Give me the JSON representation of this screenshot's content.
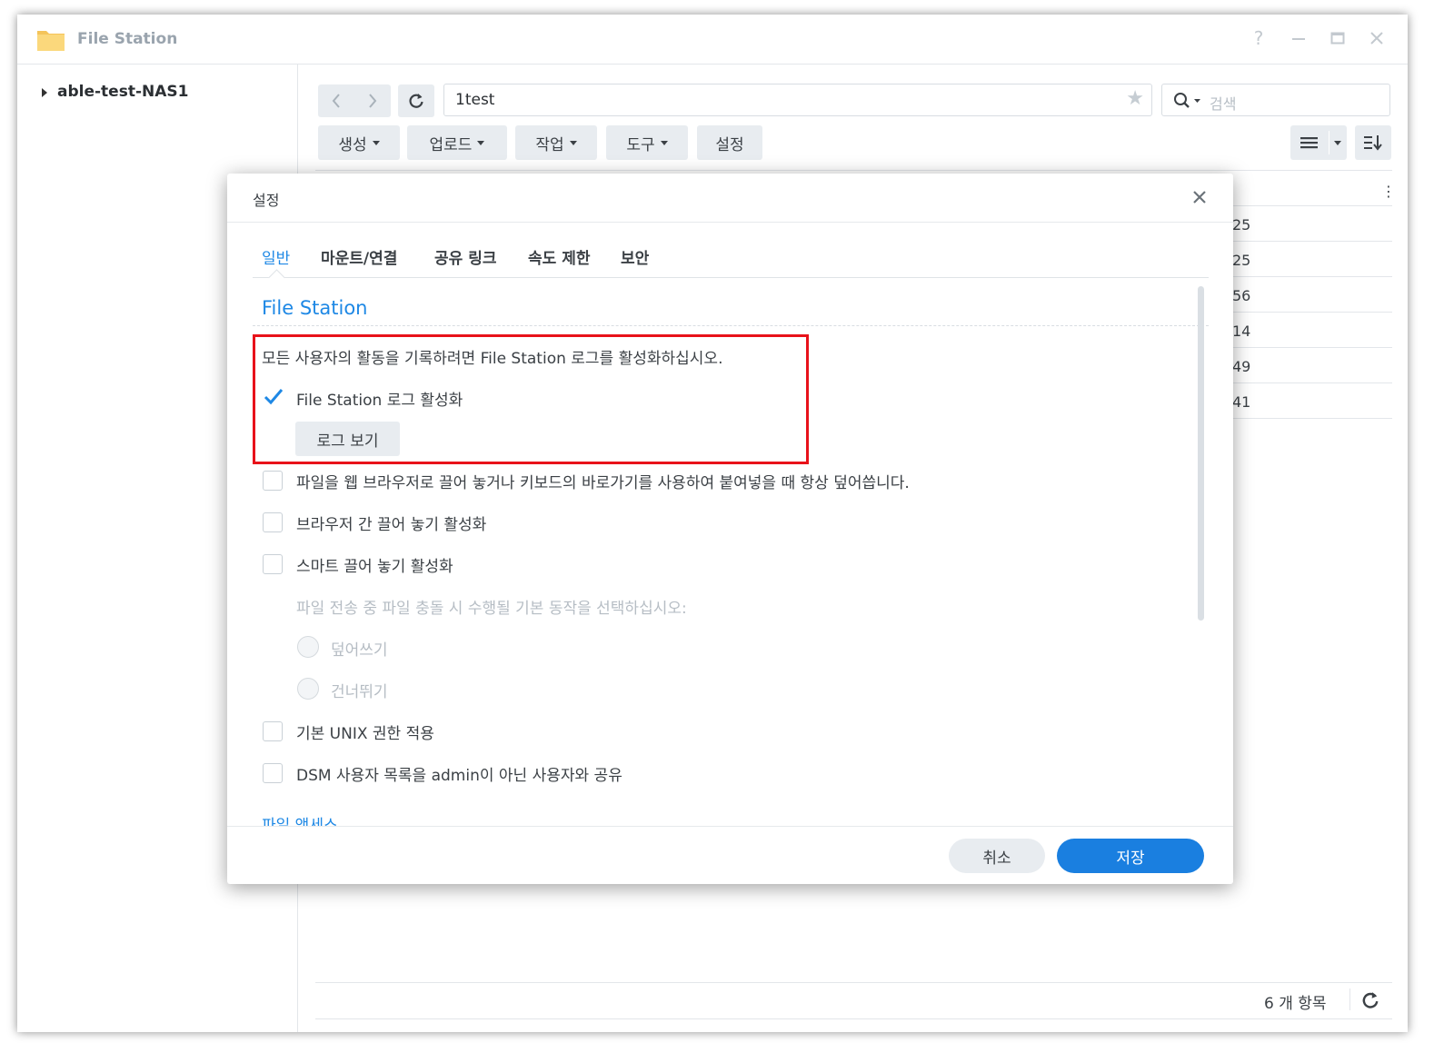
{
  "window": {
    "title": "File Station",
    "controls": [
      "help-icon",
      "minimize-icon",
      "maximize-icon",
      "close-icon"
    ]
  },
  "sidebar": {
    "tree_root": "able-test-NAS1"
  },
  "toolbar": {
    "path": "1test",
    "search_placeholder": "검색",
    "buttons": {
      "create": "생성",
      "upload": "업로드",
      "action": "작업",
      "tools": "도구",
      "settings": "설정"
    }
  },
  "file_list": {
    "partial_values": [
      "25",
      "25",
      "56",
      "14",
      "49",
      "41"
    ]
  },
  "status": {
    "item_count": "6 개 항목"
  },
  "dialog": {
    "title": "설정",
    "tabs": [
      "일반",
      "마운트/연결",
      "공유 링크",
      "속도 제한",
      "보안"
    ],
    "active_tab": "일반",
    "section_title": "File Station",
    "log_description": "모든 사용자의 활동을 기록하려면 File Station 로그를 활성화하십시오.",
    "enable_log_label": "File Station 로그 활성화",
    "enable_log_checked": true,
    "view_log_button": "로그 보기",
    "overwrite_label": "파일을 웹 브라우저로 끌어 놓거나 키보드의 바로가기를 사용하여 붙여넣을 때 항상 덮어씁니다.",
    "cross_browser_dnd_label": "브라우저 간 끌어 놓기 활성화",
    "smart_dnd_label": "스마트 끌어 놓기 활성화",
    "conflict_prompt": "파일 전송 중 파일 충돌 시 수행될 기본 동작을 선택하십시오:",
    "radio_overwrite": "덮어쓰기",
    "radio_skip": "건너뛰기",
    "unix_perm_label": "기본 UNIX 권한 적용",
    "share_user_list_label": "DSM 사용자 목록을 admin이 아닌 사용자와 공유",
    "next_section_cut": "파일 액세스",
    "cancel_button": "취소",
    "save_button": "저장"
  },
  "colors": {
    "accent": "#1e88e5",
    "save_button": "#1a7fe0",
    "highlight_box": "#e8121a"
  }
}
